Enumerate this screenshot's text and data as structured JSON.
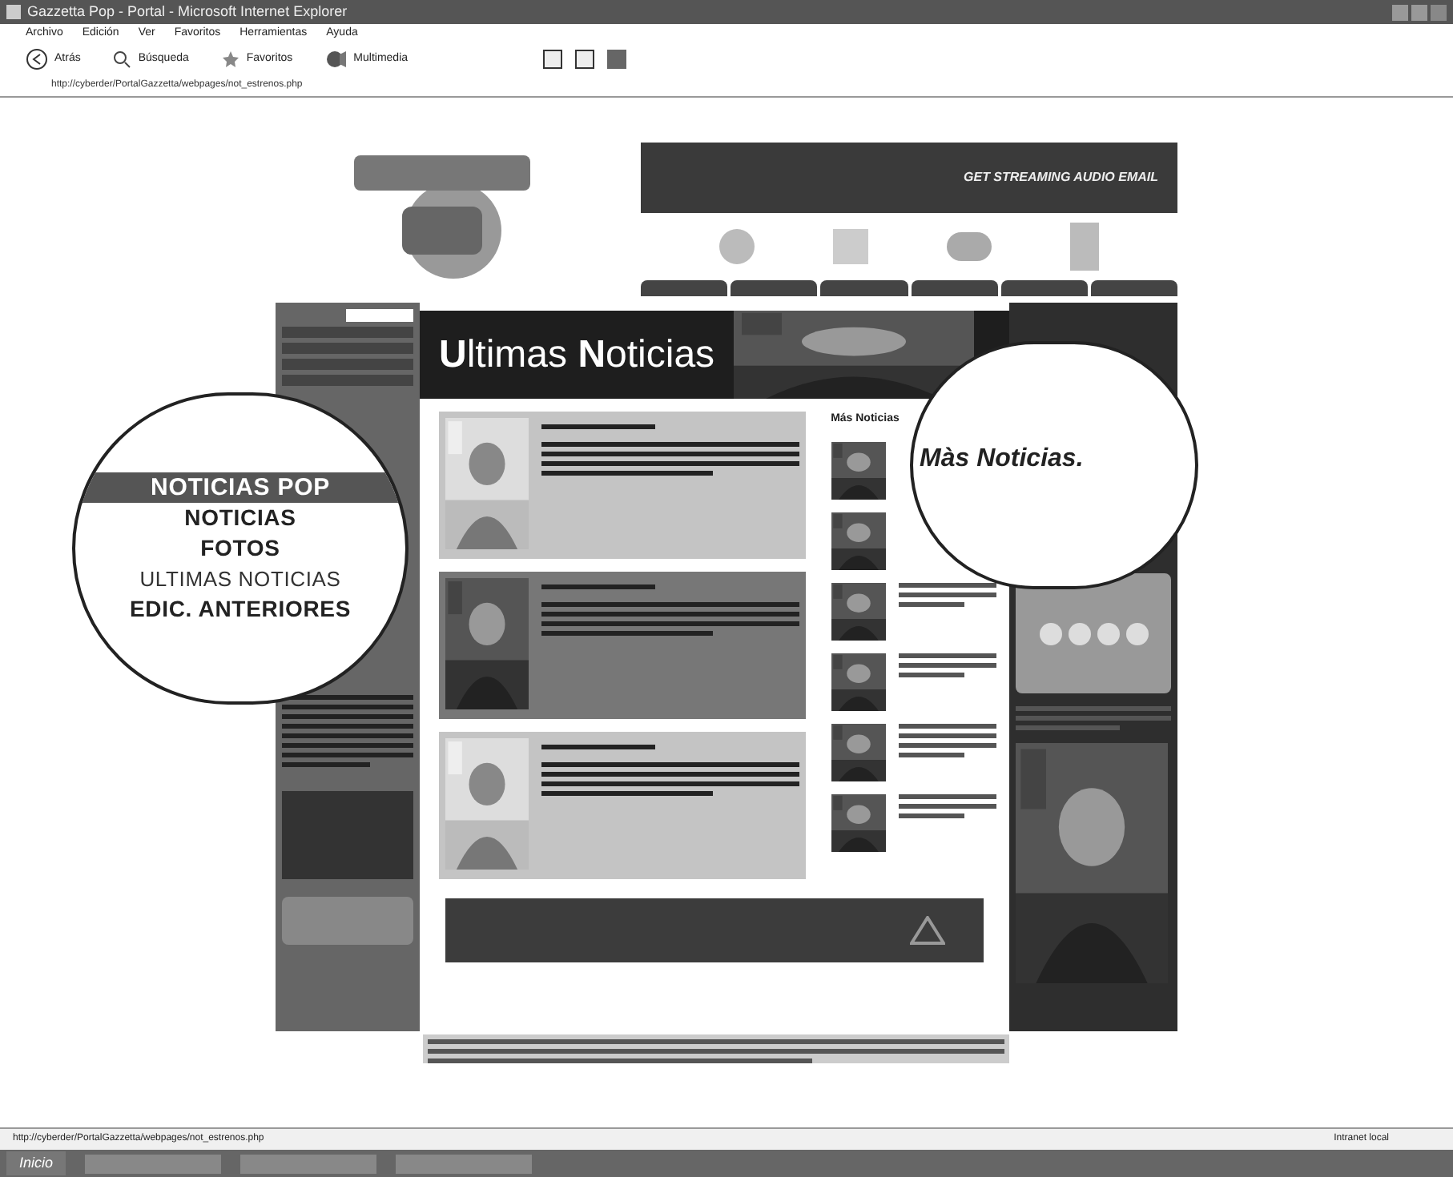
{
  "window": {
    "title": "Gazzetta Pop - Portal - Microsoft Internet Explorer"
  },
  "menu": [
    "Archivo",
    "Edición",
    "Ver",
    "Favoritos",
    "Herramientas",
    "Ayuda"
  ],
  "toolbar": [
    {
      "label": "Atrás",
      "kind": "back"
    },
    {
      "label": "Búsqueda",
      "kind": "search"
    },
    {
      "label": "Favoritos",
      "kind": "favorites"
    },
    {
      "label": "Multimedia",
      "kind": "media"
    }
  ],
  "address": {
    "value": "http://cyberder/PortalGazzetta/webpages/not_estrenos.php"
  },
  "site": {
    "banner": "GET STREAMING AUDIO EMAIL",
    "header": "**U**ltimas **N**oticias",
    "more_heading": "Más Noticias"
  },
  "callouts": {
    "menu": [
      {
        "label": "NOTICIAS POP",
        "kind": "header"
      },
      {
        "label": "NOTICIAS",
        "kind": "bold"
      },
      {
        "label": "FOTOS",
        "kind": "bold"
      },
      {
        "label": "ULTIMAS NOTICIAS",
        "kind": "light"
      },
      {
        "label": "EDIC. ANTERIORES",
        "kind": "bold"
      }
    ],
    "more": "Màs Noticias."
  },
  "status": {
    "url": "http://cyberder/PortalGazzetta/webpages/not_estrenos.php",
    "zone": "Intranet local"
  },
  "taskbar": {
    "start": "Inicio"
  }
}
